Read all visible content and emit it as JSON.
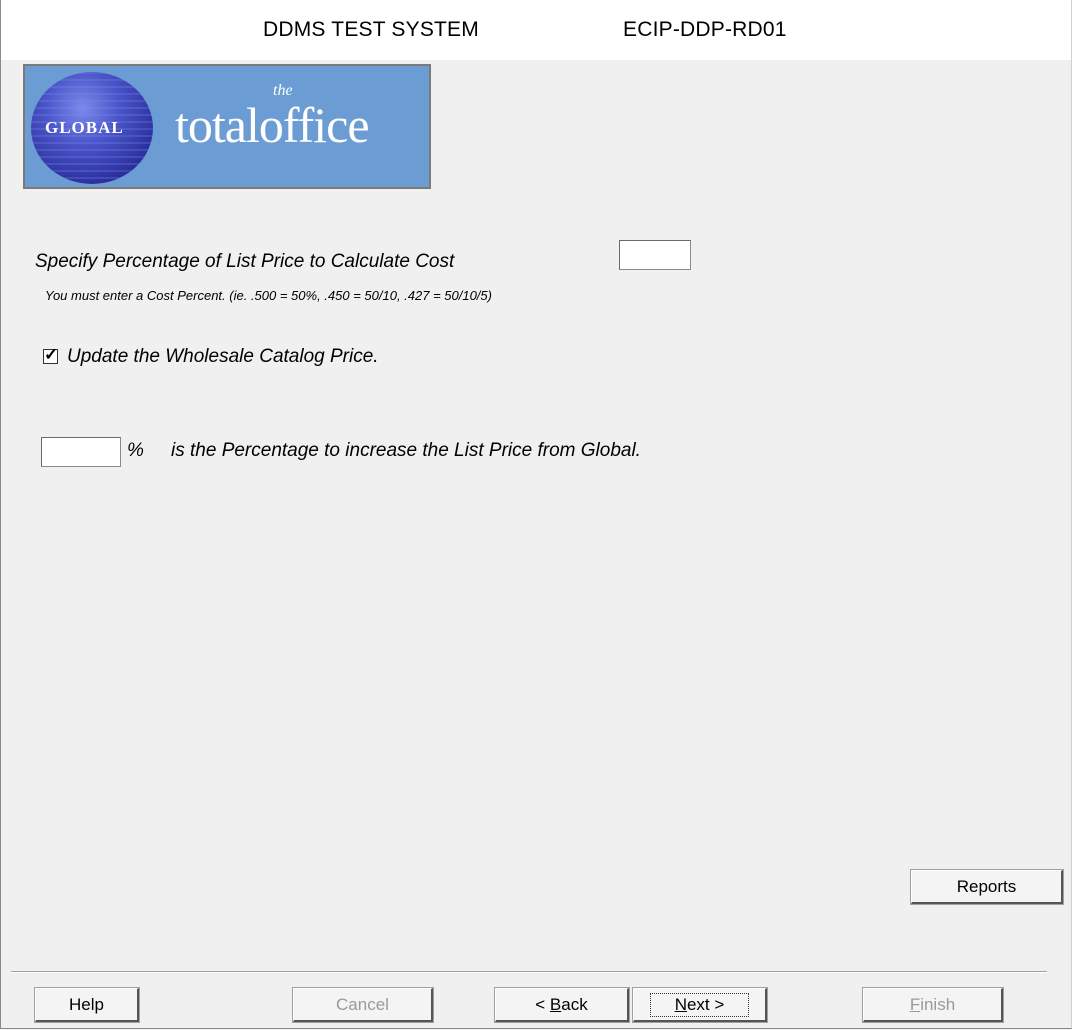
{
  "titlebar": {
    "system": "DDMS TEST SYSTEM",
    "code": "ECIP-DDP-RD01"
  },
  "logo": {
    "globe_text": "GLOBAL",
    "the_text": "the",
    "brand_text": "totaloffice",
    "background_color": "#6b9cd3"
  },
  "form": {
    "cost_label": "Specify Percentage of List Price to Calculate Cost",
    "cost_value": "",
    "cost_help": "You must enter a Cost Percent.  (ie. .500 = 50%, .450 = 50/10, .427 = 50/10/5)",
    "update_checked": true,
    "update_label": "Update the Wholesale Catalog Price.",
    "pct_value": "",
    "pct_sign": "%",
    "pct_label": "is the Percentage to increase the List Price from Global."
  },
  "buttons": {
    "reports": "Reports",
    "help": "Help",
    "cancel": "Cancel",
    "back_prefix": "< ",
    "back_accel": "B",
    "back_rest": "ack",
    "next_accel": "N",
    "next_rest": "ext >",
    "finish_accel": "F",
    "finish_rest": "inish"
  }
}
